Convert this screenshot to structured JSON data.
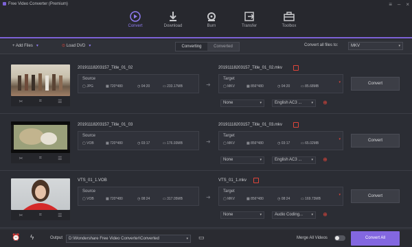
{
  "app": {
    "title": "Free Video Converter (Premium)"
  },
  "nav": [
    {
      "label": "Convert",
      "icon": "convert-icon"
    },
    {
      "label": "Download",
      "icon": "download-icon"
    },
    {
      "label": "Burn",
      "icon": "burn-icon"
    },
    {
      "label": "Transfer",
      "icon": "transfer-icon"
    },
    {
      "label": "Toolbox",
      "icon": "toolbox-icon"
    }
  ],
  "toolbar": {
    "add_files": "+ Add Files",
    "load_dvd": "Load DVD",
    "seg_converting": "Converting",
    "seg_converted": "Converted",
    "convert_all_label": "Convert all files to:",
    "convert_all_value": "MKV"
  },
  "rows": [
    {
      "src_name": "20191118203157_Title_01_02",
      "src_label": "Source",
      "src_format": "JPG",
      "src_res": "720*480",
      "src_dur": "04:20",
      "src_size": "233.17MB",
      "tgt_name": "20191118203157_Title_01_02.mkv",
      "tgt_label": "Target",
      "tgt_format": "MKV",
      "tgt_res": "856*480",
      "tgt_dur": "04:20",
      "tgt_size": "85.68MB",
      "subtitle": "None",
      "audio": "English AC3 ...",
      "convert": "Convert"
    },
    {
      "src_name": "20191118203157_Title_01_03",
      "src_label": "Source",
      "src_format": "VOB",
      "src_res": "720*480",
      "src_dur": "03:17",
      "src_size": "176.93MB",
      "tgt_name": "20191118203157_Title_01_03.mkv",
      "tgt_label": "Target",
      "tgt_format": "MKV",
      "tgt_res": "856*480",
      "tgt_dur": "03:17",
      "tgt_size": "65.02MB",
      "subtitle": "None",
      "audio": "English AC3 ...",
      "convert": "Convert"
    },
    {
      "src_name": "VTS_01_1.VOB",
      "src_label": "Source",
      "src_format": "VOB",
      "src_res": "720*480",
      "src_dur": "08:24",
      "src_size": "317.05MB",
      "tgt_name": "VTS_01_1.mkv",
      "tgt_label": "Target",
      "tgt_format": "MKV",
      "tgt_res": "856*480",
      "tgt_dur": "08:24",
      "tgt_size": "169.73MB",
      "subtitle": "None",
      "audio": "Audio Coding...",
      "convert": "Convert"
    }
  ],
  "bottom": {
    "output_label": "Output",
    "output_path": "D:\\Wondershare Free Video Converter\\Converted",
    "merge_label": "Merge All Videos",
    "convert_all": "Convert All"
  },
  "colors": {
    "accent": "#8367e0",
    "edit_red": "#e0453a"
  }
}
